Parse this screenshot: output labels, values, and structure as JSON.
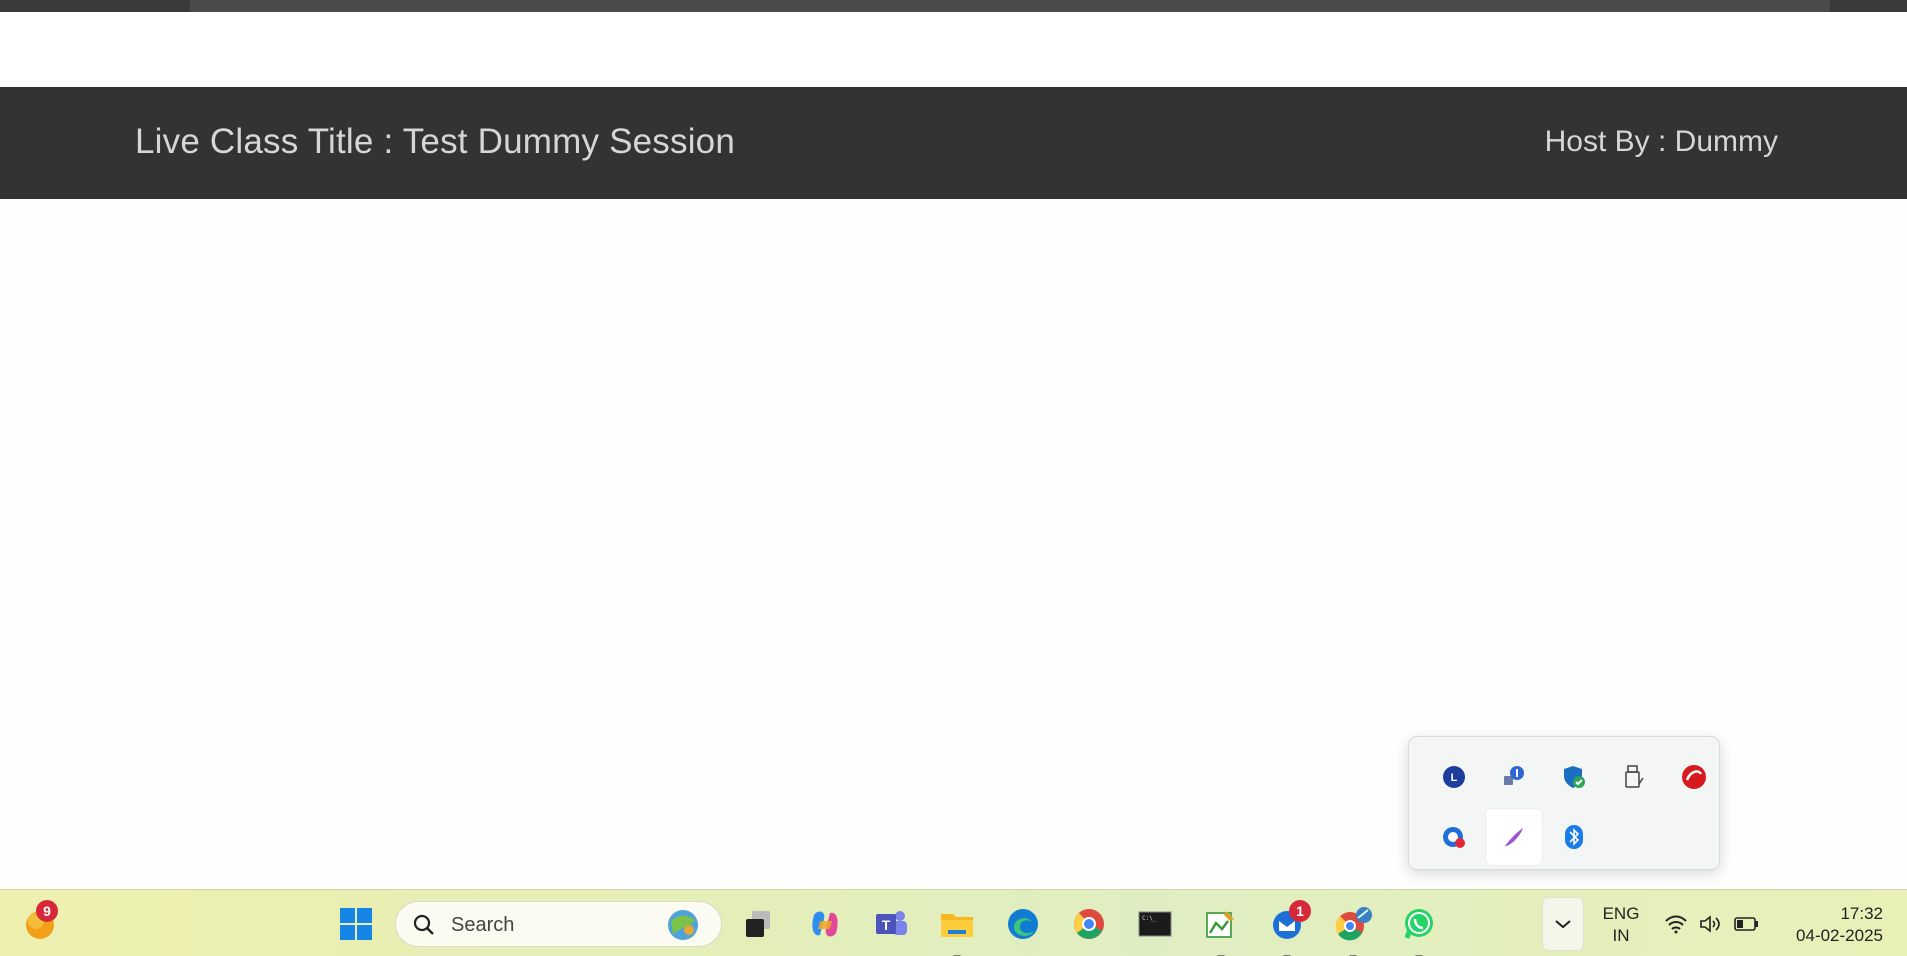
{
  "header": {
    "title": "Live Class Title : Test Dummy Session",
    "host": "Host By : Dummy"
  },
  "tray_popup": {
    "icons": [
      "lenovo-icon",
      "network-connect-icon",
      "defender-shield-icon",
      "usb-drive-icon",
      "trendmicro-icon",
      "settings-sync-icon",
      "pen-feather-icon",
      "bluetooth-icon"
    ]
  },
  "taskbar": {
    "widgets_badge": "9",
    "search_placeholder": "Search",
    "mail_badge": "1",
    "apps": [
      "start-icon",
      "task-view-icon",
      "copilot-icon",
      "teams-icon",
      "file-explorer-icon",
      "edge-icon",
      "chrome-icon",
      "terminal-icon",
      "paint-icon",
      "mail-icon",
      "chrome-profile-icon",
      "whatsapp-icon"
    ],
    "lang_line1": "ENG",
    "lang_line2": "IN",
    "time": "17:32",
    "date": "04-02-2025"
  },
  "colors": {
    "header_bg": "#333333",
    "header_text": "#d6d6d6",
    "taskbar_bg": "#e6eeb4",
    "badge": "#d7283a"
  }
}
